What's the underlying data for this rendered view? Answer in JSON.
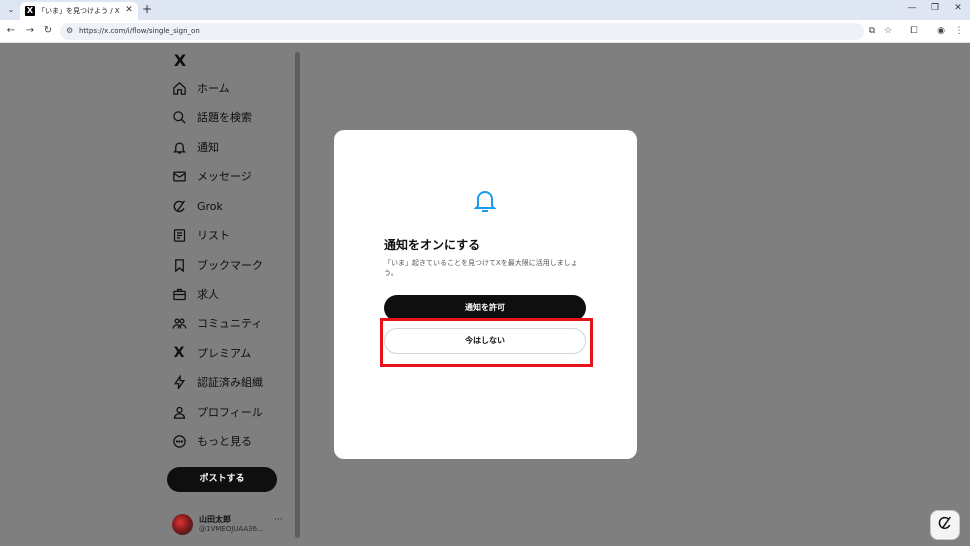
{
  "browser": {
    "tab_title": "「いま」を見つけよう / X",
    "tab_favicon": "X",
    "url": "https://x.com/i/flow/single_sign_on",
    "icons": [
      "tab-list-icon",
      "close-icon",
      "plus-icon",
      "minimize-icon",
      "restore-icon",
      "back-icon",
      "forward-icon",
      "reload-icon",
      "site-settings-icon",
      "install-app-icon",
      "star-icon",
      "extensions-icon",
      "profile-icon",
      "menu-icon"
    ]
  },
  "sidebar": {
    "logo": "X",
    "items": [
      {
        "label": "ホーム",
        "icon": "home-icon"
      },
      {
        "label": "話題を検索",
        "icon": "search-icon"
      },
      {
        "label": "通知",
        "icon": "bell-icon"
      },
      {
        "label": "メッセージ",
        "icon": "mail-icon"
      },
      {
        "label": "Grok",
        "icon": "grok-icon"
      },
      {
        "label": "リスト",
        "icon": "list-icon"
      },
      {
        "label": "ブックマーク",
        "icon": "bookmark-icon"
      },
      {
        "label": "求人",
        "icon": "briefcase-icon"
      },
      {
        "label": "コミュニティ",
        "icon": "community-icon"
      },
      {
        "label": "プレミアム",
        "icon": "x-icon"
      },
      {
        "label": "認証済み組織",
        "icon": "lightning-icon"
      },
      {
        "label": "プロフィール",
        "icon": "person-icon"
      },
      {
        "label": "もっと見る",
        "icon": "more-circle-icon"
      }
    ],
    "post_button": "ポストする",
    "account": {
      "name": "山田太郎",
      "handle": "@1VMEOJUAA36...",
      "more": "···"
    }
  },
  "modal": {
    "title": "通知をオンにする",
    "description": "「いま」起きていることを見つけてXを最大限に活用しましょう。",
    "allow_button": "通知を許可",
    "later_button": "今はしない"
  },
  "colors": {
    "overlay": "#7f7f7f",
    "accent": "#1d9bf0",
    "highlight": "#e5131b",
    "button_dark": "#0f0f0f"
  }
}
